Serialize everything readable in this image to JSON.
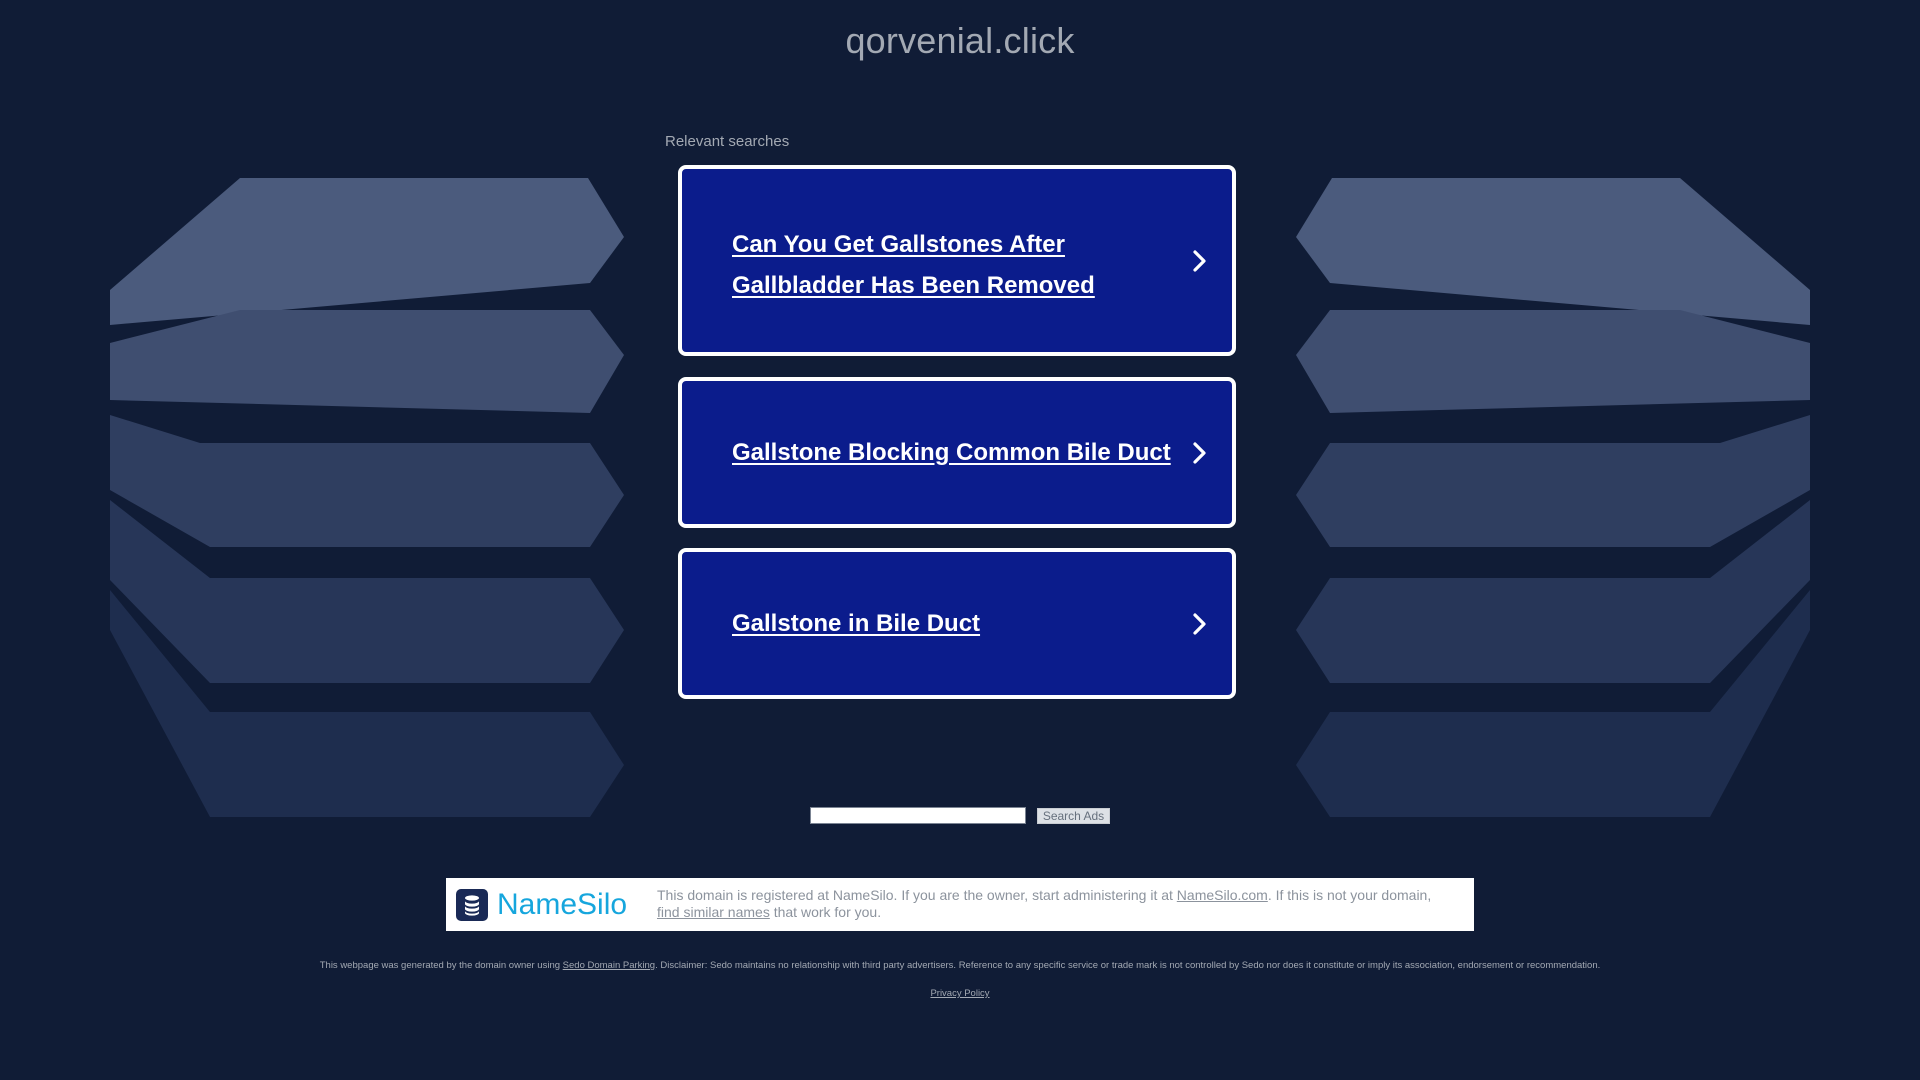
{
  "domain": "qorvenial.click",
  "relevant_searches": {
    "label": "Relevant searches",
    "items": [
      {
        "line1": "Can You Get Gallstones After",
        "line2": "Gallbladder Has Been Removed"
      },
      {
        "line1": "Gallstone Blocking Common Bile Duct",
        "line2": ""
      },
      {
        "line1": "Gallstone in Bile Duct",
        "line2": ""
      }
    ]
  },
  "search": {
    "value": "",
    "button_label": "Search Ads"
  },
  "registrar": {
    "logo_text": "NameSilo",
    "text_before_link": "This domain is registered at NameSilo. If you are the owner, start administering it at ",
    "link_label": "NameSilo.com",
    "text_after_link": ". If this is not your domain, ",
    "similar_link_label": "find similar names",
    "text_end": " that work for you."
  },
  "footer": {
    "disclaimer_before": "This webpage was generated by the domain owner using ",
    "parking_link": "Sedo Domain Parking",
    "disclaimer_after": ". Disclaimer: Sedo maintains no relationship with third party advertisers. Reference to any specific service or trade mark is not controlled by Sedo nor does it constitute or imply its association, endorsement or recommendation.",
    "privacy_label": "Privacy Policy"
  },
  "colors": {
    "background": "#101c36",
    "card": "#0b1c8c",
    "card_border": "#ffffff",
    "text_muted": "#a3a9b3",
    "brand": "#16a6dd",
    "brand_dark": "#1a2a56"
  },
  "icons": {
    "result_arrow": "chevron-right-icon",
    "logo": "database-icon"
  }
}
